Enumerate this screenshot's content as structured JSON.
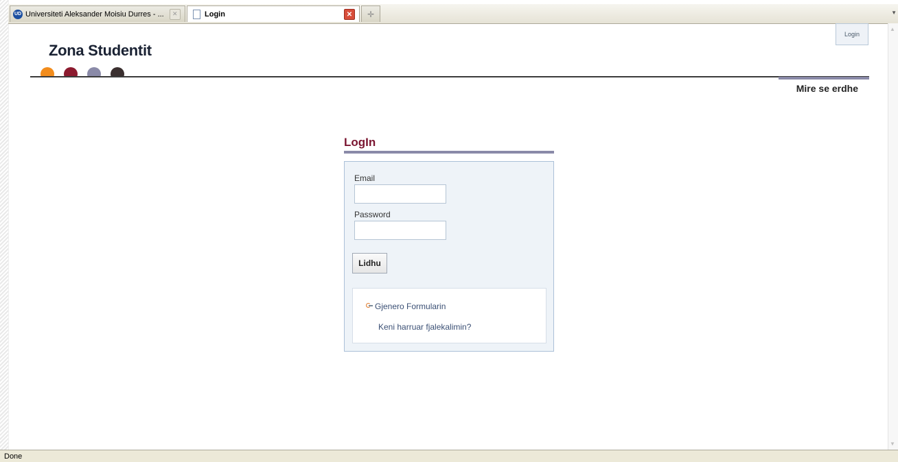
{
  "browser": {
    "tabs": [
      {
        "title": "Universiteti Aleksander Moisiu Durres - ...",
        "favicon": "ud-logo-icon"
      },
      {
        "title": "Login",
        "favicon": "page-icon"
      }
    ],
    "status": "Done"
  },
  "header": {
    "login_link": "Login",
    "logo_text": "Zona Studentit",
    "welcome": "Mire se erdhe",
    "dot_colors": [
      "#f28c1c",
      "#8c1a2e",
      "#8a8aa8",
      "#3a2f2f"
    ]
  },
  "login": {
    "title": "LogIn",
    "email_label": "Email",
    "email_value": "",
    "password_label": "Password",
    "password_value": "",
    "submit_label": "Lidhu",
    "links": {
      "generate_form": "Gjenero Formularin",
      "forgot_password": "Keni harruar fjalekalimin?"
    }
  },
  "colors": {
    "title": "#7a1530",
    "accent_bar": "#8a8aa8",
    "panel_bg": "#eef3f8",
    "link": "#3a4f74"
  }
}
